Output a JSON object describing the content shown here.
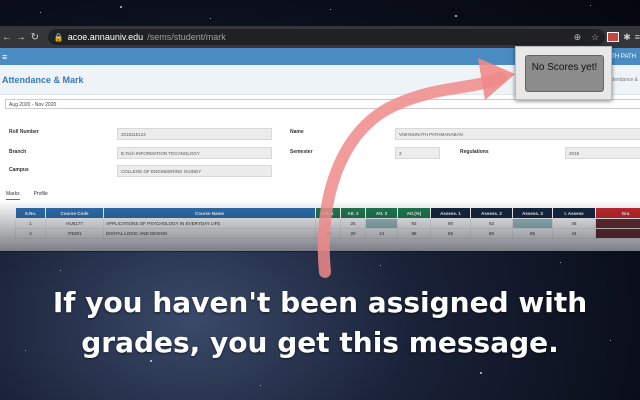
{
  "browser": {
    "url_host": "acoe.annauniv.edu",
    "url_path": "/sems/student/mark",
    "extension_count": "1"
  },
  "app": {
    "title": "Attendance & Mark",
    "user_name": "ANATH PATH",
    "breadcrumb": "Attendance &",
    "semester_select": "Aug 2020 - Nov 2020"
  },
  "profile": {
    "roll_label": "Roll Number",
    "roll_value": "2018115124",
    "name_label": "Name",
    "name_value": "VISHNUNATH PATHMANABAN",
    "branch_label": "Branch",
    "branch_value": "B.Tech INFORMATION TECHNOLOGY",
    "semester_label": "Semester",
    "semester_value": "3",
    "regulations_label": "Regulations",
    "regulations_value": "2019",
    "campus_label": "Campus",
    "campus_value": "COLLEGE OF ENGINEERING GUINDY"
  },
  "tabs": [
    "Marks",
    "Profile"
  ],
  "table": {
    "headers": [
      "S.No.",
      "Course Code",
      "Course Name",
      "Att. 1",
      "Att. 2",
      "Att. 3",
      "Att.(%)",
      "Assess. 1",
      "Assess. 2",
      "Assess. 3",
      "I. Assess",
      "Gra"
    ],
    "rows": [
      [
        "1",
        "HU5177",
        "APPLICATIONS OF PSYCHOLOGY IN EVERYDAY LIFE",
        "17",
        "25",
        "",
        "93",
        "90",
        "92",
        "",
        "46",
        ""
      ],
      [
        "2",
        "IT5301",
        "DIGITAL LOGIC AND DESIGN",
        "23",
        "20",
        "14",
        "98",
        "93",
        "80",
        "85",
        "44",
        ""
      ]
    ]
  },
  "popup": {
    "message": "No Scores yet!"
  },
  "caption": {
    "line1": "If you haven't been assigned with",
    "line2": "grades, you get this message."
  },
  "colors": {
    "header_blue": "#2f6fb0",
    "header_green": "#1f7a4f",
    "header_navy": "#13263f",
    "header_red": "#c4282d",
    "arrow_pink": "#f08a8a"
  }
}
